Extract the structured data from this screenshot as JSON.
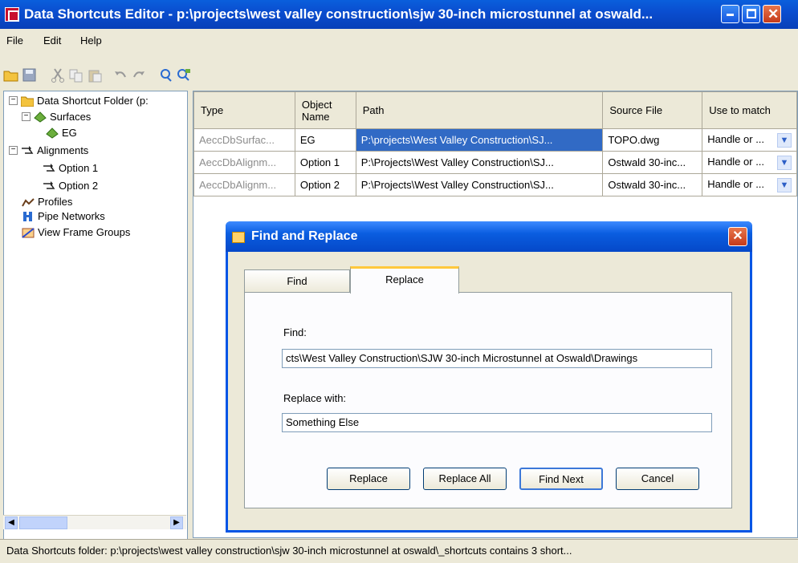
{
  "window": {
    "title": "Data Shortcuts Editor - p:\\projects\\west valley construction\\sjw 30-inch microstunnel at oswald..."
  },
  "menu": [
    "File",
    "Edit",
    "Help"
  ],
  "tree": {
    "root": "Data Shortcut Folder (p:",
    "surfaces": "Surfaces",
    "eg": "EG",
    "alignments": "Alignments",
    "option1": "Option 1",
    "option2": "Option 2",
    "profiles": "Profiles",
    "pipe_networks": "Pipe Networks",
    "view_frame_groups": "View Frame Groups"
  },
  "table": {
    "headers": [
      "Type",
      "Object Name",
      "Path",
      "Source File",
      "Use to match"
    ],
    "rows": [
      [
        "AeccDbSurfac...",
        "EG",
        "P:\\projects\\West Valley Construction\\SJ...",
        "TOPO.dwg",
        "Handle or ..."
      ],
      [
        "AeccDbAlignm...",
        "Option 1",
        "P:\\Projects\\West Valley Construction\\SJ...",
        "Ostwald 30-inc...",
        "Handle or ..."
      ],
      [
        "AeccDbAlignm...",
        "Option 2",
        "P:\\Projects\\West Valley Construction\\SJ...",
        "Ostwald 30-inc...",
        "Handle or ..."
      ]
    ]
  },
  "dialog": {
    "title": "Find and Replace",
    "tabs": [
      "Find",
      "Replace"
    ],
    "find_label": "Find:",
    "find_value": "cts\\West Valley Construction\\SJW 30-inch Microstunnel at Oswald\\Drawings",
    "replace_label": "Replace with:",
    "replace_value": "Something Else",
    "buttons": [
      "Replace",
      "Replace All",
      "Find Next",
      "Cancel"
    ]
  },
  "status": "Data Shortcuts folder: p:\\projects\\west valley construction\\sjw 30-inch microstunnel at oswald\\_shortcuts contains 3 short..."
}
